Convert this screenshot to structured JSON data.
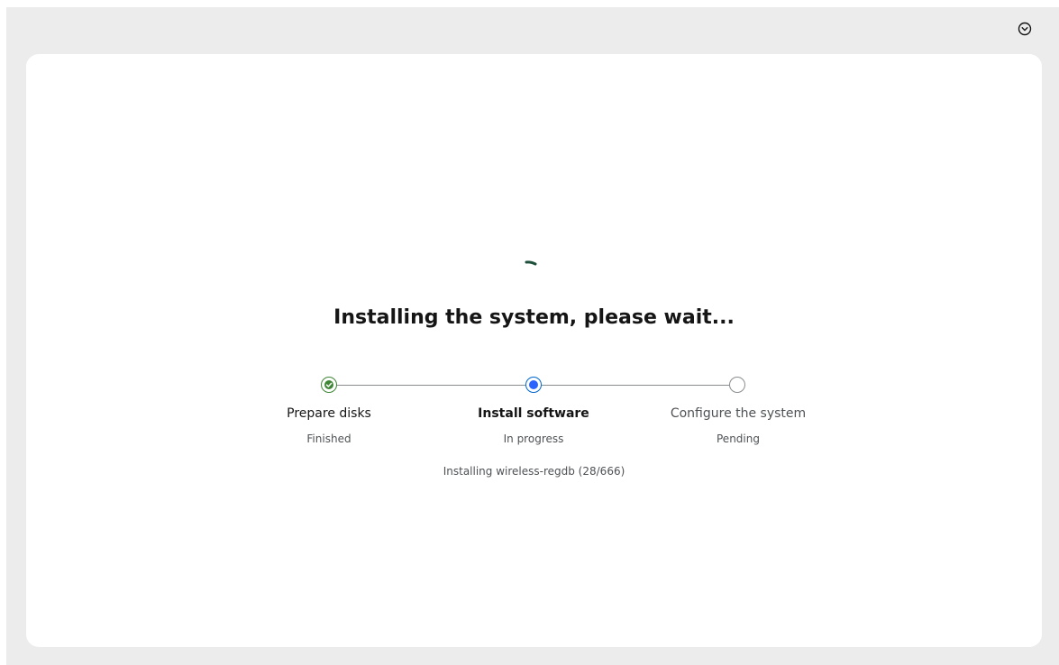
{
  "header": {
    "menu_icon": "chevron-down-circle-icon"
  },
  "installer": {
    "spinner_icon": "loading-spinner-icon",
    "title": "Installing the system, please wait...",
    "steps": [
      {
        "label": "Prepare disks",
        "status": "Finished",
        "state": "done",
        "icon": "check-circle-icon"
      },
      {
        "label": "Install software",
        "status": "In progress",
        "state": "current",
        "icon": "current-dot-icon"
      },
      {
        "label": "Configure the system",
        "status": "Pending",
        "state": "pending",
        "icon": "empty-circle-icon"
      }
    ],
    "detail": "Installing wireless-regdb (28/666)"
  },
  "colors": {
    "background": "#ececec",
    "card": "#ffffff",
    "success": "#3e8635",
    "current": "#2b63ff",
    "pending_border": "#8a8d90",
    "spinner": "#1e4f3a"
  }
}
